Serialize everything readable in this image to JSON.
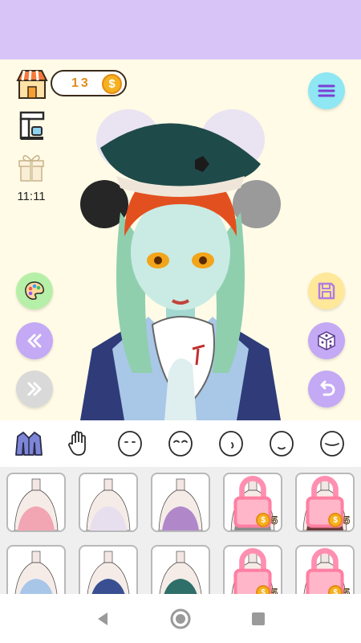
{
  "hud": {
    "coins": "13",
    "coin_symbol": "$",
    "gift_timer": "11:11"
  },
  "categories": [
    {
      "name": "outfit",
      "icon": "jacket-icon"
    },
    {
      "name": "hand",
      "icon": "hand-icon"
    },
    {
      "name": "face-1",
      "icon": "face-icon"
    },
    {
      "name": "face-2",
      "icon": "smile-face-icon"
    },
    {
      "name": "face-3",
      "icon": "side-face-icon"
    },
    {
      "name": "face-4",
      "icon": "mouth-face-icon"
    },
    {
      "name": "face-5",
      "icon": "sad-face-icon"
    }
  ],
  "items": [
    {
      "locked": false,
      "price": ""
    },
    {
      "locked": false,
      "price": ""
    },
    {
      "locked": false,
      "price": ""
    },
    {
      "locked": true,
      "price": "5"
    },
    {
      "locked": true,
      "price": "5"
    },
    {
      "locked": false,
      "price": ""
    },
    {
      "locked": false,
      "price": ""
    },
    {
      "locked": false,
      "price": ""
    },
    {
      "locked": true,
      "price": "5"
    },
    {
      "locked": true,
      "price": "5"
    }
  ],
  "colors": {
    "banner": "#d8c4f7",
    "stage_bg": "#fffbe6",
    "menu_btn": "#8ee7f2",
    "palette_btn": "#b6f0a8",
    "purple_btn": "#c4a9f5",
    "save_btn": "#ffe89a",
    "coin": "#f6b11f"
  }
}
